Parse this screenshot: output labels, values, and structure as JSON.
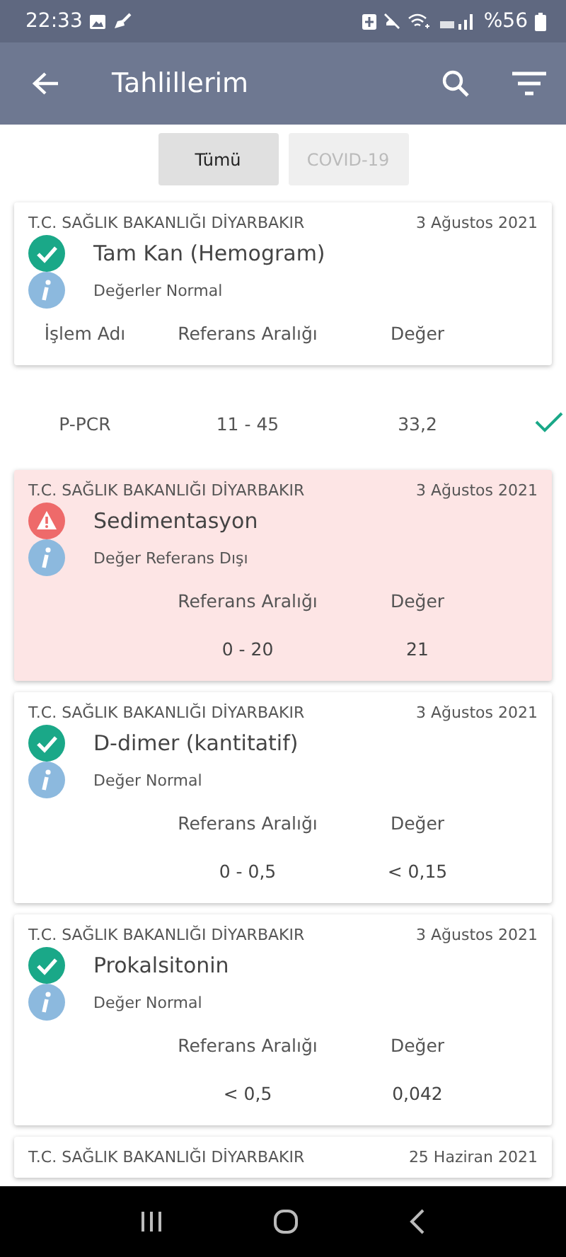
{
  "status_bar": {
    "time": "22:33",
    "battery": "%56"
  },
  "app_bar": {
    "title": "Tahlillerim"
  },
  "filters": [
    {
      "label": "Tümü",
      "selected": true
    },
    {
      "label": "COVID-19",
      "selected": false
    }
  ],
  "results": [
    {
      "kind": "card",
      "out_of_range": false,
      "institution": "T.C. SAĞLIK BAKANLIĞI DİYARBAKIR",
      "date": "3 Ağustos 2021",
      "title": "Tam Kan (Hemogram)",
      "note": "Değerler Normal",
      "columns": {
        "name": "İşlem Adı",
        "range": "Referans Aralığı",
        "value": "Değer"
      }
    },
    {
      "kind": "row",
      "name": "P-PCR",
      "range": "11 - 45",
      "value": "33,2",
      "checked": true
    },
    {
      "kind": "card",
      "out_of_range": true,
      "institution": "T.C. SAĞLIK BAKANLIĞI DİYARBAKIR",
      "date": "3 Ağustos 2021",
      "title": "Sedimentasyon",
      "note": "Değer Referans Dışı",
      "columns": {
        "range": "Referans Aralığı",
        "value": "Değer"
      },
      "values": {
        "range": "0 - 20",
        "value": "21"
      }
    },
    {
      "kind": "card",
      "out_of_range": false,
      "institution": "T.C. SAĞLIK BAKANLIĞI DİYARBAKIR",
      "date": "3 Ağustos 2021",
      "title": "D-dimer (kantitatif)",
      "note": "Değer Normal",
      "columns": {
        "range": "Referans Aralığı",
        "value": "Değer"
      },
      "values": {
        "range": "0 - 0,5",
        "value": "< 0,15"
      }
    },
    {
      "kind": "card",
      "out_of_range": false,
      "institution": "T.C. SAĞLIK BAKANLIĞI DİYARBAKIR",
      "date": "3 Ağustos 2021",
      "title": "Prokalsitonin",
      "note": "Değer Normal",
      "columns": {
        "range": "Referans Aralığı",
        "value": "Değer"
      },
      "values": {
        "range": "< 0,5",
        "value": "0,042"
      }
    },
    {
      "kind": "card",
      "institution": "T.C. SAĞLIK BAKANLIĞI DİYARBAKIR",
      "date": "25 Haziran 2021"
    }
  ]
}
